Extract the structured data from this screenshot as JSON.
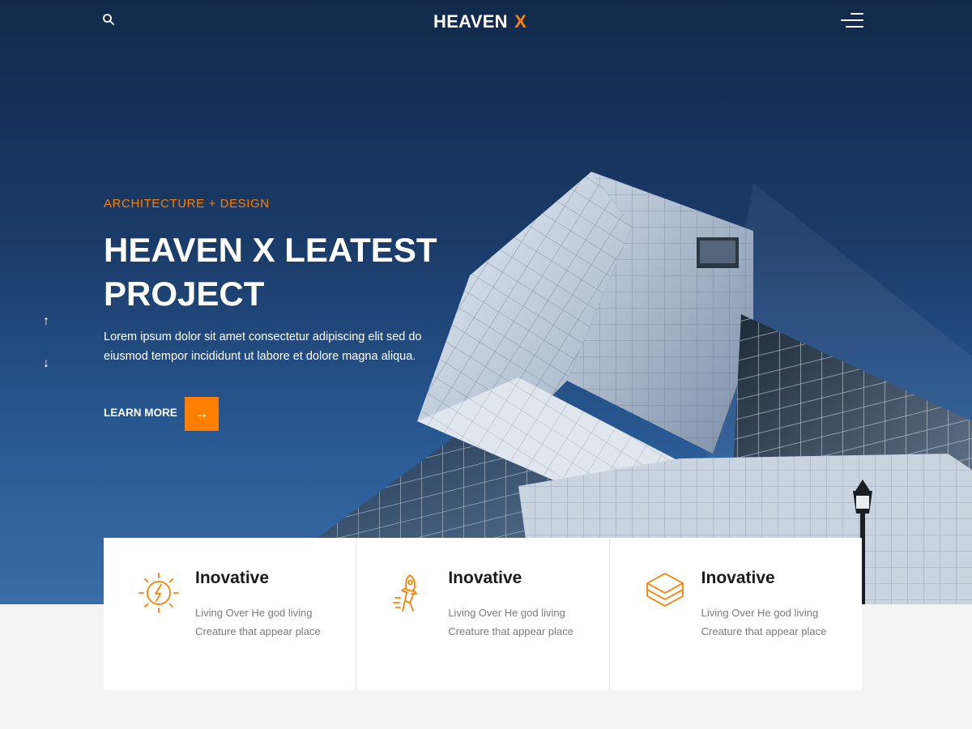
{
  "header": {
    "logo_main": "HEAVEN",
    "logo_accent": "X",
    "search_icon": "search-icon",
    "menu_icon": "hamburger-menu-icon"
  },
  "hero": {
    "eyebrow": "ARCHITECTURE + DESIGN",
    "title_line1": "HEAVEN X LEATEST",
    "title_line2": "PROJECT",
    "description": "Lorem ipsum dolor sit amet consectetur adipiscing elit sed do eiusmod tempor incididunt ut labore et dolore magna aliqua.",
    "cta_label": "LEARN MORE",
    "cta_icon": "arrow-right-icon",
    "arrow_up": "↑",
    "arrow_down": "↓",
    "cta_arrow": "→"
  },
  "features": [
    {
      "icon": "sun-bolt-icon",
      "title": "Inovative",
      "text": "Living Over He god living Creature that appear place"
    },
    {
      "icon": "rocket-astronaut-icon",
      "title": "Inovative",
      "text": "Living Over He god living Creature that appear place"
    },
    {
      "icon": "layers-icon",
      "title": "Inovative",
      "text": "Living Over He god living Creature that appear place"
    }
  ],
  "colors": {
    "accent": "#ff7f00",
    "hero_bg_top": "#12294a",
    "hero_bg_bottom": "#3a6ca6",
    "page_bg": "#f4f4f4"
  }
}
